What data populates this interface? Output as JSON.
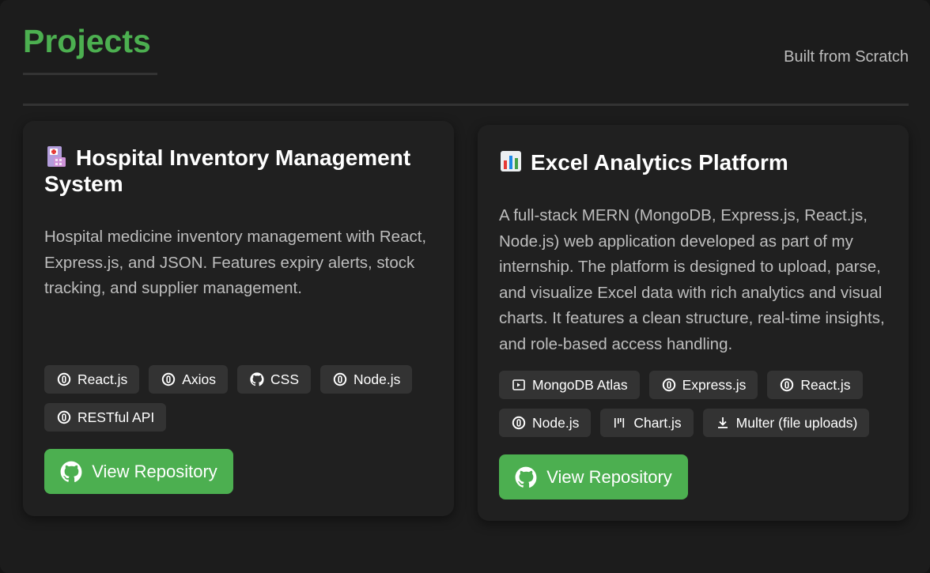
{
  "header": {
    "title": "Projects",
    "subtitle": "Built from Scratch"
  },
  "projects": [
    {
      "emoji_icon": "hospital-icon",
      "title": "Hospital Inventory Management System",
      "description": "Hospital medicine inventory management with React, Express.js, and JSON. Features expiry alerts, stock tracking, and supplier management.",
      "tags": [
        {
          "label": "React.js",
          "icon": "tech-circle-icon"
        },
        {
          "label": "Axios",
          "icon": "tech-circle-icon"
        },
        {
          "label": "CSS",
          "icon": "github-icon"
        },
        {
          "label": "Node.js",
          "icon": "tech-circle-icon"
        },
        {
          "label": "RESTful API",
          "icon": "tech-circle-icon"
        }
      ],
      "button_label": "View Repository"
    },
    {
      "emoji_icon": "bar-chart-icon",
      "title": "Excel Analytics Platform",
      "description": "A full-stack MERN (MongoDB, Express.js, React.js, Node.js) web application developed as part of my internship. The platform is designed to upload, parse, and visualize Excel data with rich analytics and visual charts. It features a clean structure, real-time insights, and role-based access handling.",
      "tags": [
        {
          "label": "MongoDB Atlas",
          "icon": "database-icon"
        },
        {
          "label": "Express.js",
          "icon": "tech-circle-icon"
        },
        {
          "label": "React.js",
          "icon": "tech-circle-icon"
        },
        {
          "label": "Node.js",
          "icon": "tech-circle-icon"
        },
        {
          "label": "Chart.js",
          "icon": "chart-bars-icon"
        },
        {
          "label": "Multer (file uploads)",
          "icon": "download-icon"
        }
      ],
      "button_label": "View Repository"
    }
  ],
  "colors": {
    "accent": "#4caf50",
    "background": "#1c1c1c",
    "card": "#202020",
    "tag": "#333333"
  }
}
